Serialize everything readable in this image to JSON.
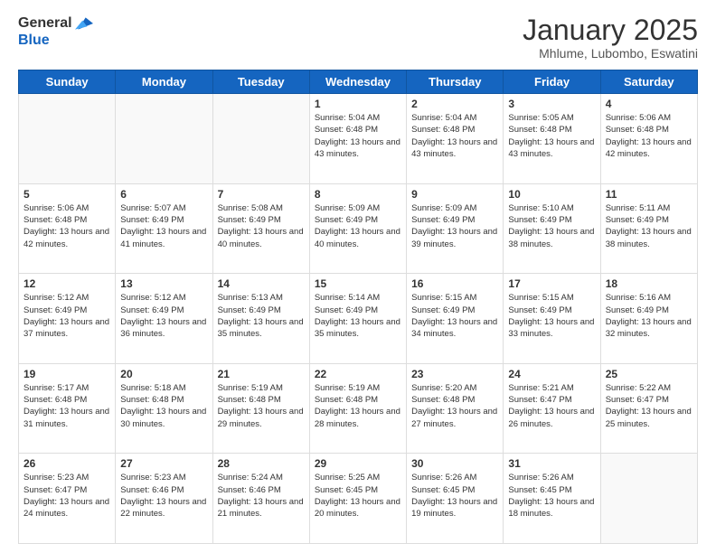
{
  "header": {
    "logo": {
      "general": "General",
      "blue": "Blue"
    },
    "title": "January 2025",
    "location": "Mhlume, Lubombo, Eswatini"
  },
  "days_of_week": [
    "Sunday",
    "Monday",
    "Tuesday",
    "Wednesday",
    "Thursday",
    "Friday",
    "Saturday"
  ],
  "weeks": [
    [
      {
        "day": "",
        "info": ""
      },
      {
        "day": "",
        "info": ""
      },
      {
        "day": "",
        "info": ""
      },
      {
        "day": "1",
        "info": "Sunrise: 5:04 AM\nSunset: 6:48 PM\nDaylight: 13 hours and 43 minutes."
      },
      {
        "day": "2",
        "info": "Sunrise: 5:04 AM\nSunset: 6:48 PM\nDaylight: 13 hours and 43 minutes."
      },
      {
        "day": "3",
        "info": "Sunrise: 5:05 AM\nSunset: 6:48 PM\nDaylight: 13 hours and 43 minutes."
      },
      {
        "day": "4",
        "info": "Sunrise: 5:06 AM\nSunset: 6:48 PM\nDaylight: 13 hours and 42 minutes."
      }
    ],
    [
      {
        "day": "5",
        "info": "Sunrise: 5:06 AM\nSunset: 6:48 PM\nDaylight: 13 hours and 42 minutes."
      },
      {
        "day": "6",
        "info": "Sunrise: 5:07 AM\nSunset: 6:49 PM\nDaylight: 13 hours and 41 minutes."
      },
      {
        "day": "7",
        "info": "Sunrise: 5:08 AM\nSunset: 6:49 PM\nDaylight: 13 hours and 40 minutes."
      },
      {
        "day": "8",
        "info": "Sunrise: 5:09 AM\nSunset: 6:49 PM\nDaylight: 13 hours and 40 minutes."
      },
      {
        "day": "9",
        "info": "Sunrise: 5:09 AM\nSunset: 6:49 PM\nDaylight: 13 hours and 39 minutes."
      },
      {
        "day": "10",
        "info": "Sunrise: 5:10 AM\nSunset: 6:49 PM\nDaylight: 13 hours and 38 minutes."
      },
      {
        "day": "11",
        "info": "Sunrise: 5:11 AM\nSunset: 6:49 PM\nDaylight: 13 hours and 38 minutes."
      }
    ],
    [
      {
        "day": "12",
        "info": "Sunrise: 5:12 AM\nSunset: 6:49 PM\nDaylight: 13 hours and 37 minutes."
      },
      {
        "day": "13",
        "info": "Sunrise: 5:12 AM\nSunset: 6:49 PM\nDaylight: 13 hours and 36 minutes."
      },
      {
        "day": "14",
        "info": "Sunrise: 5:13 AM\nSunset: 6:49 PM\nDaylight: 13 hours and 35 minutes."
      },
      {
        "day": "15",
        "info": "Sunrise: 5:14 AM\nSunset: 6:49 PM\nDaylight: 13 hours and 35 minutes."
      },
      {
        "day": "16",
        "info": "Sunrise: 5:15 AM\nSunset: 6:49 PM\nDaylight: 13 hours and 34 minutes."
      },
      {
        "day": "17",
        "info": "Sunrise: 5:15 AM\nSunset: 6:49 PM\nDaylight: 13 hours and 33 minutes."
      },
      {
        "day": "18",
        "info": "Sunrise: 5:16 AM\nSunset: 6:49 PM\nDaylight: 13 hours and 32 minutes."
      }
    ],
    [
      {
        "day": "19",
        "info": "Sunrise: 5:17 AM\nSunset: 6:48 PM\nDaylight: 13 hours and 31 minutes."
      },
      {
        "day": "20",
        "info": "Sunrise: 5:18 AM\nSunset: 6:48 PM\nDaylight: 13 hours and 30 minutes."
      },
      {
        "day": "21",
        "info": "Sunrise: 5:19 AM\nSunset: 6:48 PM\nDaylight: 13 hours and 29 minutes."
      },
      {
        "day": "22",
        "info": "Sunrise: 5:19 AM\nSunset: 6:48 PM\nDaylight: 13 hours and 28 minutes."
      },
      {
        "day": "23",
        "info": "Sunrise: 5:20 AM\nSunset: 6:48 PM\nDaylight: 13 hours and 27 minutes."
      },
      {
        "day": "24",
        "info": "Sunrise: 5:21 AM\nSunset: 6:47 PM\nDaylight: 13 hours and 26 minutes."
      },
      {
        "day": "25",
        "info": "Sunrise: 5:22 AM\nSunset: 6:47 PM\nDaylight: 13 hours and 25 minutes."
      }
    ],
    [
      {
        "day": "26",
        "info": "Sunrise: 5:23 AM\nSunset: 6:47 PM\nDaylight: 13 hours and 24 minutes."
      },
      {
        "day": "27",
        "info": "Sunrise: 5:23 AM\nSunset: 6:46 PM\nDaylight: 13 hours and 22 minutes."
      },
      {
        "day": "28",
        "info": "Sunrise: 5:24 AM\nSunset: 6:46 PM\nDaylight: 13 hours and 21 minutes."
      },
      {
        "day": "29",
        "info": "Sunrise: 5:25 AM\nSunset: 6:45 PM\nDaylight: 13 hours and 20 minutes."
      },
      {
        "day": "30",
        "info": "Sunrise: 5:26 AM\nSunset: 6:45 PM\nDaylight: 13 hours and 19 minutes."
      },
      {
        "day": "31",
        "info": "Sunrise: 5:26 AM\nSunset: 6:45 PM\nDaylight: 13 hours and 18 minutes."
      },
      {
        "day": "",
        "info": ""
      }
    ]
  ]
}
